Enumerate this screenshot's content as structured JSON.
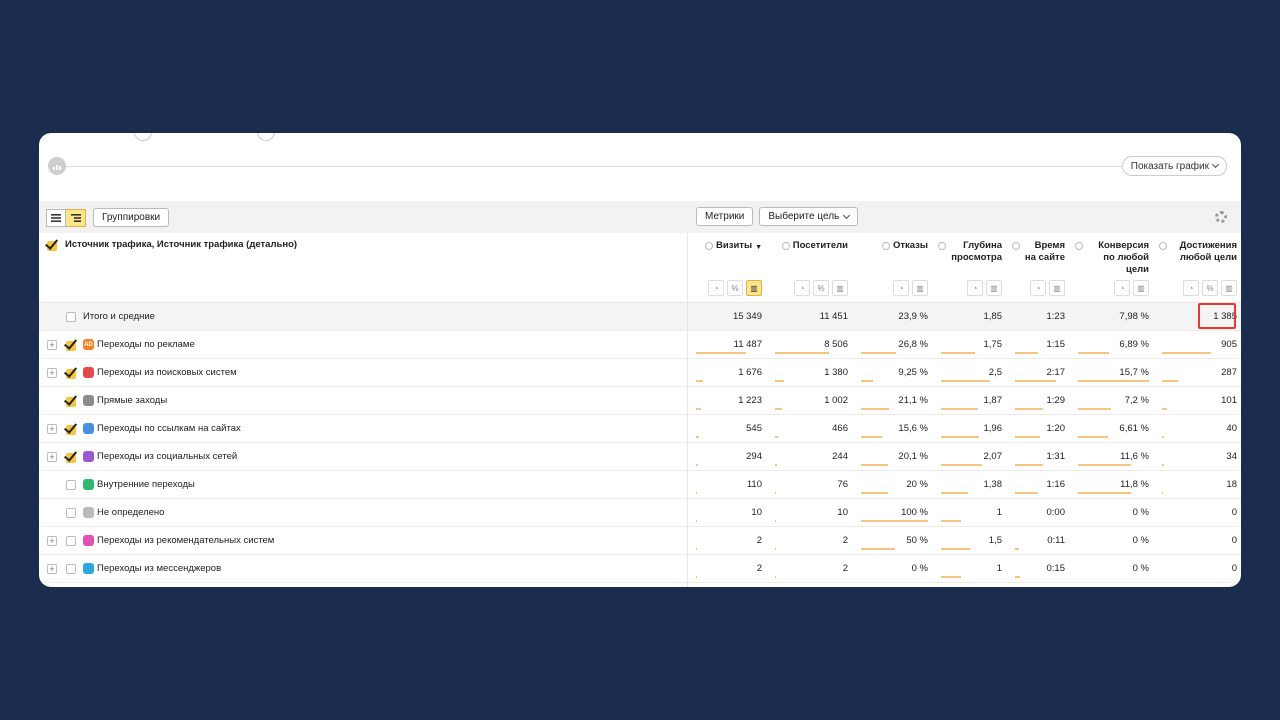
{
  "chart": {
    "show_chart_label": "Показать график"
  },
  "toolbar": {
    "groupings_label": "Группировки",
    "metrics_label": "Метрики",
    "goal_label": "Выберите цель"
  },
  "table": {
    "dimension_header": "Источник трафика, Источник трафика (детально)",
    "total_label": "Итого и средние",
    "columns": [
      {
        "key": "visits",
        "label": "Визиты",
        "sort": "▼"
      },
      {
        "key": "visitors",
        "label": "Посетители",
        "sort": ""
      },
      {
        "key": "bounce",
        "label": "Отказы",
        "sort": ""
      },
      {
        "key": "depth",
        "label": "Глубина просмотра",
        "sort": ""
      },
      {
        "key": "time",
        "label": "Время на сайте",
        "sort": ""
      },
      {
        "key": "conversion",
        "label": "Конверсия по любой цели",
        "sort": ""
      },
      {
        "key": "goals",
        "label": "Достижения любой цели",
        "sort": ""
      }
    ],
    "totals": [
      "15 349",
      "11 451",
      "23,9 %",
      "1,85",
      "1:23",
      "7,98 %",
      "1 385"
    ],
    "rows": [
      {
        "label": "Переходы по рекламе",
        "icon": "ad-icon",
        "icon_color": "#f58220",
        "icon_text": "AD",
        "expandable": true,
        "checked": true,
        "values": [
          "11 487",
          "8 506",
          "26,8 %",
          "1,75",
          "1:15",
          "6,89 %",
          "905"
        ],
        "bars": [
          0.75,
          0.74,
          0.52,
          0.55,
          0.45,
          0.43,
          0.65
        ]
      },
      {
        "label": "Переходы из поисковых систем",
        "icon": "search-icon",
        "icon_color": "#e5484d",
        "icon_text": "",
        "expandable": true,
        "checked": true,
        "values": [
          "1 676",
          "1 380",
          "9,25 %",
          "2,5",
          "2:17",
          "15,7 %",
          "287"
        ],
        "bars": [
          0.11,
          0.12,
          0.18,
          0.8,
          0.82,
          1.0,
          0.21
        ]
      },
      {
        "label": "Прямые заходы",
        "icon": "direct-icon",
        "icon_color": "#8c8c8c",
        "icon_text": "",
        "expandable": false,
        "checked": true,
        "values": [
          "1 223",
          "1 002",
          "21,1 %",
          "1,87",
          "1:29",
          "7,2 %",
          "101"
        ],
        "bars": [
          0.08,
          0.09,
          0.42,
          0.6,
          0.55,
          0.46,
          0.07
        ]
      },
      {
        "label": "Переходы по ссылкам на сайтах",
        "icon": "link-icon",
        "icon_color": "#4a90e2",
        "icon_text": "",
        "expandable": true,
        "checked": true,
        "values": [
          "545",
          "466",
          "15,6 %",
          "1,96",
          "1:20",
          "6,61 %",
          "40"
        ],
        "bars": [
          0.04,
          0.04,
          0.31,
          0.63,
          0.5,
          0.42,
          0.03
        ]
      },
      {
        "label": "Переходы из социальных сетей",
        "icon": "social-icon",
        "icon_color": "#9b59d0",
        "icon_text": "",
        "expandable": true,
        "checked": true,
        "values": [
          "294",
          "244",
          "20,1 %",
          "2,07",
          "1:31",
          "11,6 %",
          "34"
        ],
        "bars": [
          0.03,
          0.03,
          0.4,
          0.67,
          0.56,
          0.74,
          0.03
        ]
      },
      {
        "label": "Внутренние переходы",
        "icon": "home-icon",
        "icon_color": "#2eb872",
        "icon_text": "",
        "expandable": false,
        "checked": false,
        "values": [
          "110",
          "76",
          "20 %",
          "1,38",
          "1:16",
          "11,8 %",
          "18"
        ],
        "bars": [
          0.01,
          0.01,
          0.4,
          0.44,
          0.46,
          0.75,
          0.01
        ]
      },
      {
        "label": "Не определено",
        "icon": "undefined-icon",
        "icon_color": "#bbbbbb",
        "icon_text": "",
        "expandable": false,
        "checked": false,
        "values": [
          "10",
          "10",
          "100 %",
          "1",
          "0:00",
          "0 %",
          "0"
        ],
        "bars": [
          0.005,
          0.005,
          1.0,
          0.32,
          0.0,
          0.0,
          0.0
        ]
      },
      {
        "label": "Переходы из рекомендательных систем",
        "icon": "thumbs-up-icon",
        "icon_color": "#e052b4",
        "icon_text": "",
        "expandable": true,
        "checked": false,
        "values": [
          "2",
          "2",
          "50 %",
          "1,5",
          "0:11",
          "0 %",
          "0"
        ],
        "bars": [
          0.002,
          0.002,
          0.5,
          0.48,
          0.07,
          0.0,
          0.0
        ]
      },
      {
        "label": "Переходы из мессенджеров",
        "icon": "messenger-icon",
        "icon_color": "#29a9e0",
        "icon_text": "",
        "expandable": true,
        "checked": false,
        "values": [
          "2",
          "2",
          "0 %",
          "1",
          "0:15",
          "0 %",
          "0"
        ],
        "bars": [
          0.002,
          0.002,
          0.0,
          0.32,
          0.09,
          0.0,
          0.0
        ]
      }
    ]
  }
}
